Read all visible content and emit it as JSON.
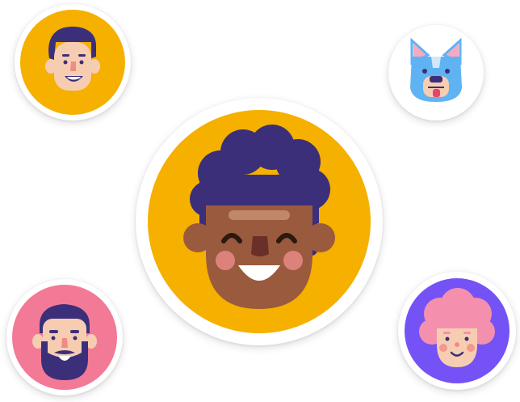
{
  "colors": {
    "yellow": "#f5b000",
    "pink": "#f27a96",
    "purple": "#7452f5",
    "navy": "#3b2f7a",
    "skin_light": "#f7cdb2",
    "skin_dark": "#9a5a3d",
    "dog_blue": "#5fb3f3",
    "dog_pink": "#f7a9c0",
    "hair_pink": "#f58fae"
  },
  "avatars": [
    {
      "id": "man-brown-hair",
      "icon": "man-avatar-icon",
      "background": "#f5b000"
    },
    {
      "id": "bulldog",
      "icon": "dog-avatar-icon",
      "background": "#ffffff"
    },
    {
      "id": "curly-hair-boy",
      "icon": "curly-hair-avatar-icon",
      "background": "#f5b000"
    },
    {
      "id": "bearded-man",
      "icon": "bearded-man-avatar-icon",
      "background": "#f27a96"
    },
    {
      "id": "pink-hair-girl",
      "icon": "girl-avatar-icon",
      "background": "#7452f5"
    }
  ]
}
